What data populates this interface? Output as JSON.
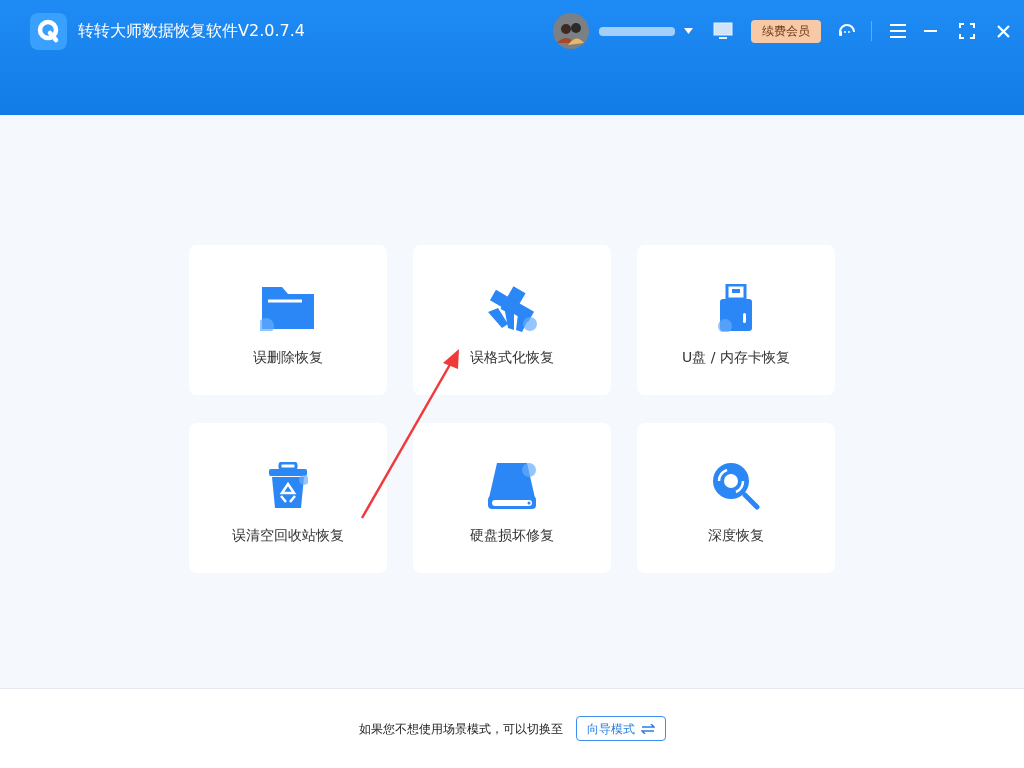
{
  "window": {
    "title": "转转大师数据恢复软件V2.0.7.4"
  },
  "header": {
    "vip_button": "续费会员"
  },
  "cards": [
    {
      "kind": "folder",
      "label": "误删除恢复"
    },
    {
      "kind": "broom",
      "label": "误格式化恢复"
    },
    {
      "kind": "usb",
      "label": "U盘 / 内存卡恢复"
    },
    {
      "kind": "trash",
      "label": "误清空回收站恢复"
    },
    {
      "kind": "disk",
      "label": "硬盘损坏修复"
    },
    {
      "kind": "scan",
      "label": "深度恢复"
    }
  ],
  "footer": {
    "hint": "如果您不想使用场景模式，可以切换至",
    "switch_button": "向导模式"
  }
}
